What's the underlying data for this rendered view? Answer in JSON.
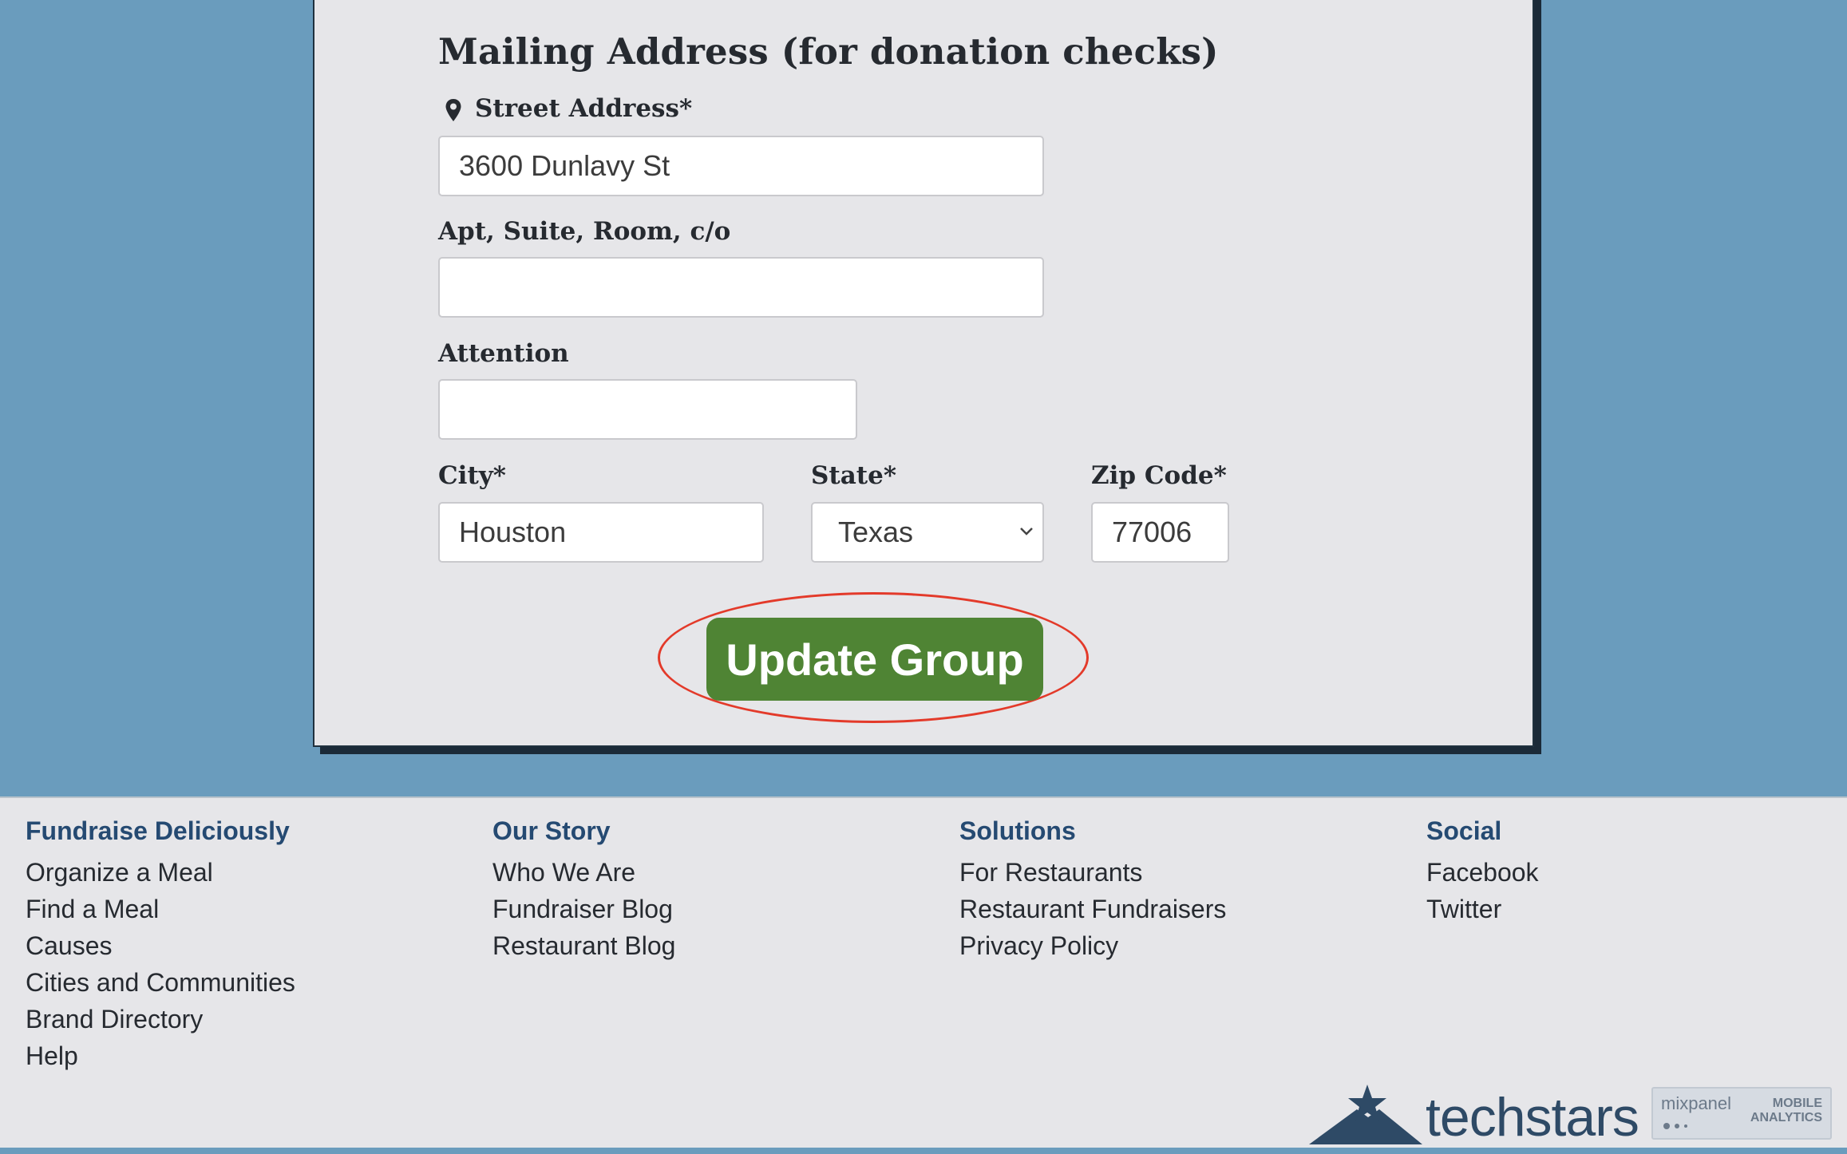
{
  "form": {
    "section_title": "Mailing Address (for donation checks)",
    "street": {
      "label": "Street Address*",
      "value": "3600 Dunlavy St",
      "icon": "map-pin-icon"
    },
    "apt": {
      "label": "Apt, Suite, Room, c/o",
      "value": ""
    },
    "attention": {
      "label": "Attention",
      "value": ""
    },
    "city": {
      "label": "City*",
      "value": "Houston"
    },
    "state": {
      "label": "State*",
      "selected": "Texas"
    },
    "zip": {
      "label": "Zip Code*",
      "value": "77006"
    },
    "submit_label": "Update Group"
  },
  "footer": {
    "columns": [
      {
        "heading": "Fundraise Deliciously",
        "links": [
          "Organize a Meal",
          "Find a Meal",
          "Causes",
          "Cities and Communities",
          "Brand Directory",
          "Help"
        ]
      },
      {
        "heading": "Our Story",
        "links": [
          "Who We Are",
          "Fundraiser Blog",
          "Restaurant Blog"
        ]
      },
      {
        "heading": "Solutions",
        "links": [
          "For Restaurants",
          "Restaurant Fundraisers",
          "Privacy Policy"
        ]
      },
      {
        "heading": "Social",
        "links": [
          "Facebook",
          "Twitter"
        ]
      }
    ],
    "logos": {
      "techstars": "techstars",
      "mixpanel_name": "mixpanel",
      "mixpanel_line1": "MOBILE",
      "mixpanel_line2": "ANALYTICS"
    }
  },
  "colors": {
    "page_bg": "#6a9cbd",
    "card_bg": "#e6e6e9",
    "button_green": "#4f8434",
    "highlight_red": "#e33a2a",
    "footer_heading": "#254a72"
  }
}
